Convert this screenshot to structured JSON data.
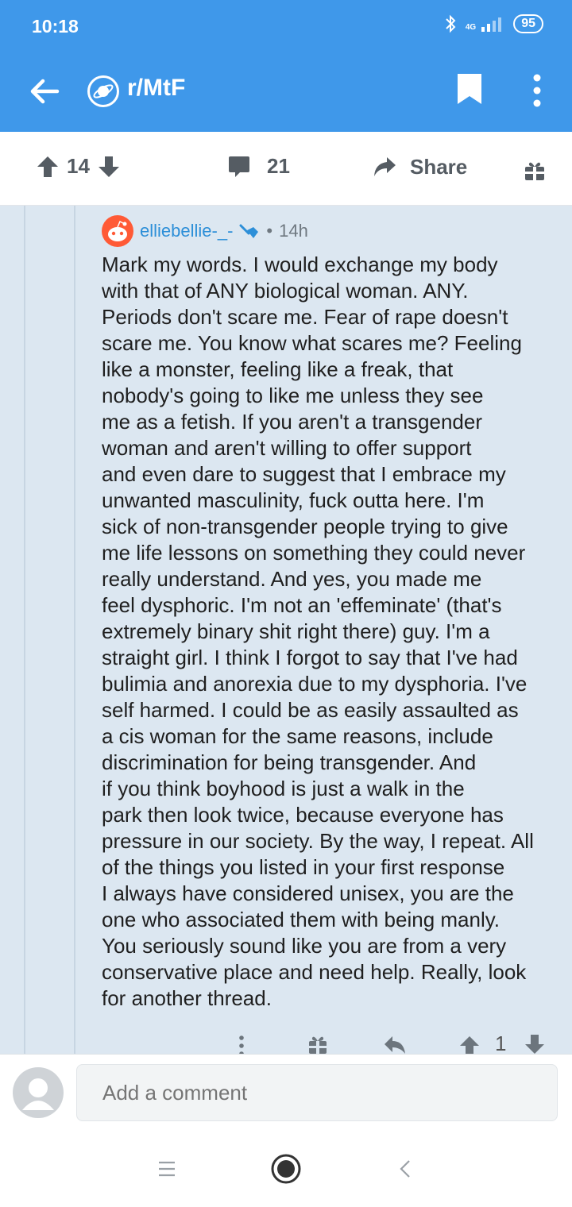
{
  "status": {
    "time": "10:18",
    "network": "4G",
    "battery": "95"
  },
  "header": {
    "subreddit": "r/MtF"
  },
  "post_actions": {
    "upvotes": "14",
    "comments": "21",
    "share": "Share"
  },
  "comment": {
    "author": "elliebellie-_-",
    "age": "14h",
    "text": "Mark my words. I would exchange my body\nwith that of ANY biological woman. ANY.\nPeriods don't scare me. Fear of rape doesn't\nscare me. You know what scares me? Feeling\nlike a monster, feeling like a freak, that\nnobody's going to like me unless they see\nme as a fetish. If you aren't a transgender\nwoman and aren't willing to offer support\nand even dare to suggest that I embrace my\nunwanted masculinity, fuck outta here. I'm\nsick of non-transgender people trying to give\nme life lessons on something they could never\nreally understand. And yes, you made me\nfeel dysphoric. I'm not an 'effeminate' (that's\nextremely binary shit right there) guy. I'm a\nstraight girl. I think I forgot to say that I've had\nbulimia and anorexia due to my dysphoria. I've\nself harmed. I could be as easily assaulted as\na cis woman for the same reasons, include\ndiscrimination for being transgender. And\nif you think boyhood is just a walk in the\npark then look twice, because everyone has\npressure in our society. By the way, I repeat. All\nof the things you listed in your first response\nI always have considered unisex, you are the\none who associated them with being manly.\nYou seriously sound like you are from a very\nconservative place and need help. Really, look\nfor another thread.",
    "votes": "1"
  },
  "composer": {
    "placeholder": "Add a comment"
  },
  "colors": {
    "brand": "#3f98ea",
    "comment_bg": "#dce7f1",
    "author": "#2d8fd8"
  }
}
